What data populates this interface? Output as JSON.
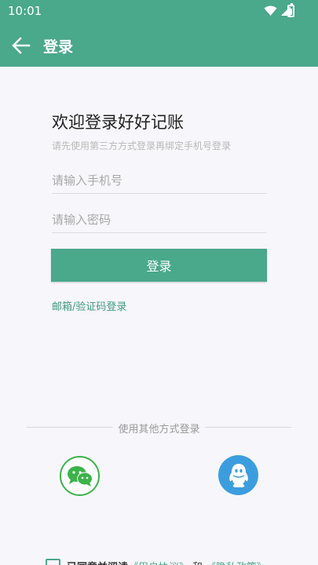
{
  "status_bar": {
    "time": "10:01"
  },
  "toolbar": {
    "title": "登录"
  },
  "main": {
    "welcome": "欢迎登录好好记账",
    "subtitle": "请先使用第三方方式登录再绑定手机号登录",
    "phone_placeholder": "请输入手机号",
    "password_placeholder": "请输入密码",
    "login_button": "登录",
    "alt_login_link": "邮箱/验证码登录"
  },
  "other_login": {
    "divider_text": "使用其他方式登录",
    "options": [
      {
        "icon": "wechat-icon"
      },
      {
        "icon": "qq-icon"
      }
    ]
  },
  "agreement": {
    "prefix": "已同意并阅读",
    "terms_link": "《用户协议》",
    "separator": "和",
    "privacy_link": "《隐私政策》"
  },
  "colors": {
    "primary": "#4aa88b",
    "wechat": "#3bb34a",
    "qq": "#3c9dde"
  }
}
